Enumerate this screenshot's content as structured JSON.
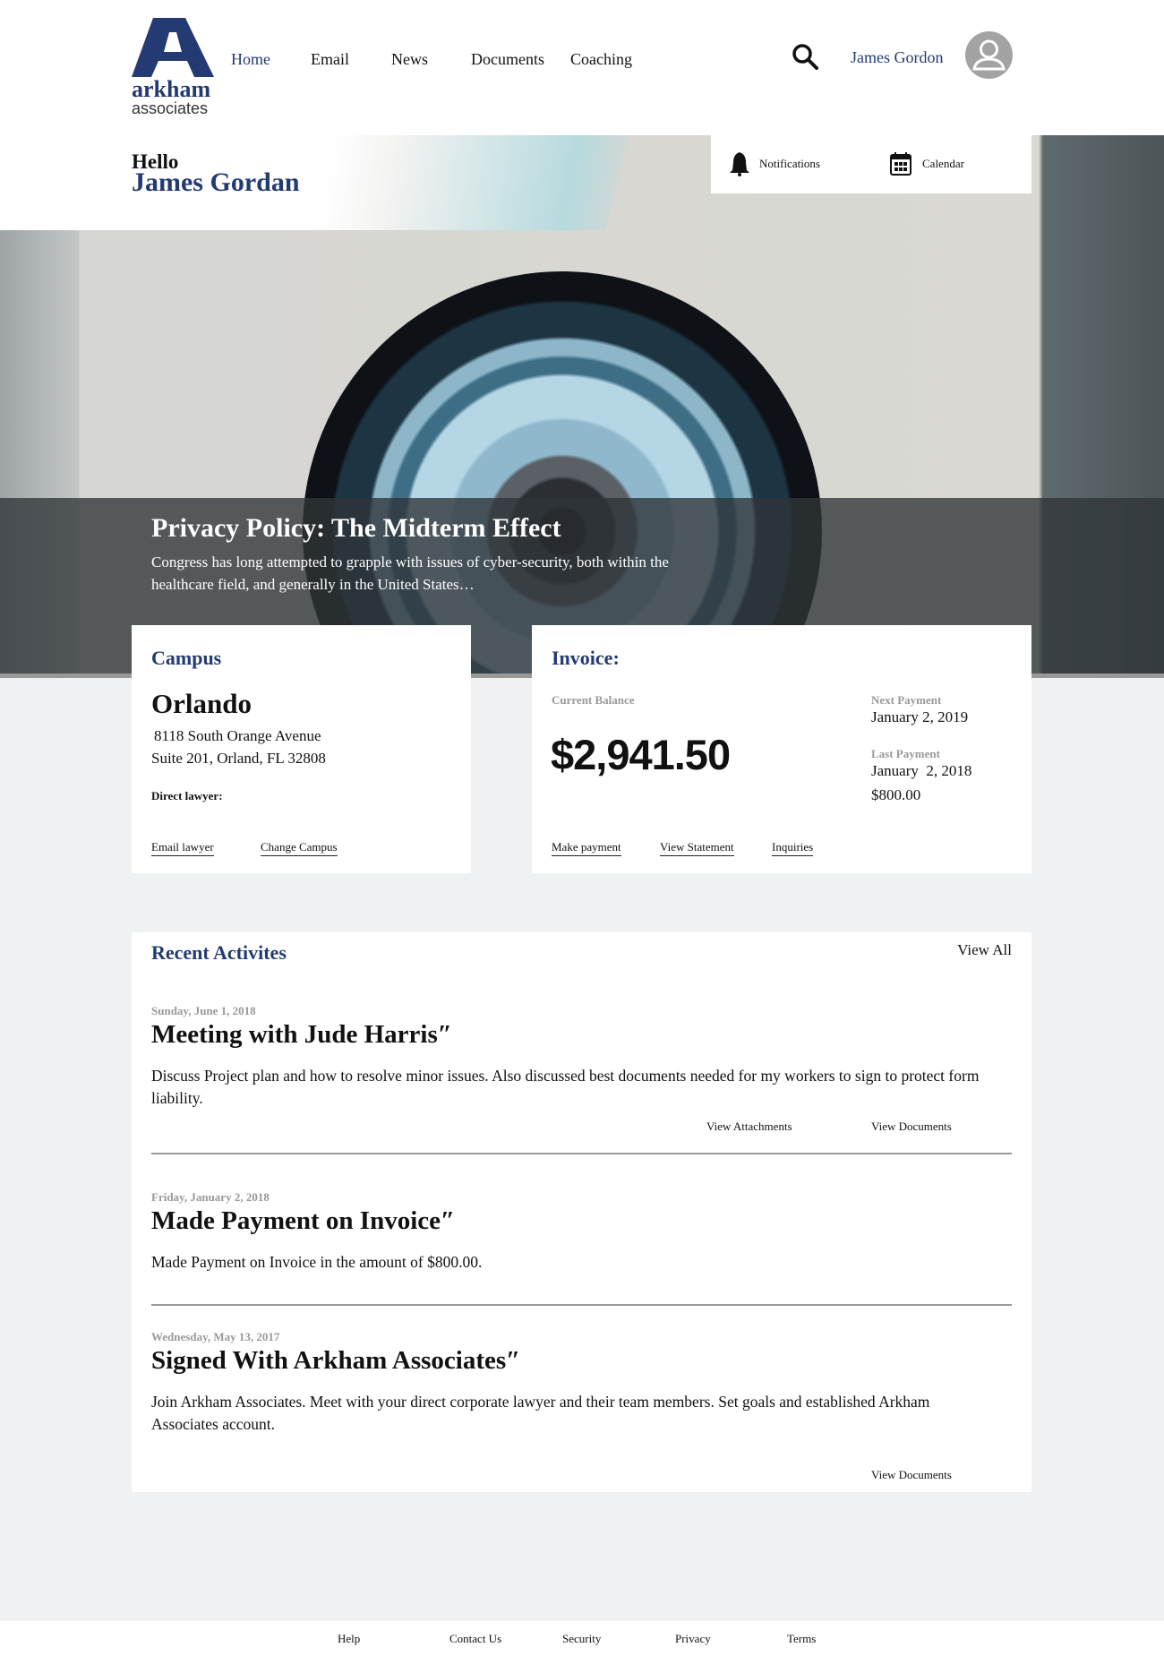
{
  "brand": {
    "logo_letter": "A",
    "name": "arkham",
    "sub": "associates",
    "color": "#233a72"
  },
  "nav": {
    "items": [
      {
        "label": "Home",
        "active": true
      },
      {
        "label": "Email"
      },
      {
        "label": "News"
      },
      {
        "label": "Documents"
      },
      {
        "label": "Coaching"
      }
    ]
  },
  "user": {
    "name": "James Gordon",
    "search_icon": "search-icon",
    "avatar_icon": "user-avatar-icon"
  },
  "greeting": {
    "hello": "Hello",
    "name": "James Gordan"
  },
  "quick": {
    "notifications": "Notifications",
    "calendar": "Calendar"
  },
  "hero": {
    "title": "Privacy Policy: The Midterm Effect",
    "desc_line1": "Congress has long attempted to grapple with issues of cyber-security, both within the",
    "desc_line2": "healthcare field, and generally in the United States…"
  },
  "campus": {
    "heading": "Campus",
    "city": "Orlando",
    "address1": "8118 South Orange Avenue",
    "address2": "Suite 201, Orland, FL 32808",
    "lawyer_label": "Direct lawyer:",
    "links": [
      "Email lawyer",
      "Change Campus"
    ]
  },
  "invoice": {
    "heading": "Invoice:",
    "balance_label": "Current Balance",
    "balance": "$2,941.50",
    "next_label": "Next Payment",
    "next_date": "January 2, 2019",
    "last_label": "Last Payment",
    "last_date": "January  2, 2018",
    "last_amount": "$800.00",
    "links": [
      "Make payment",
      "View Statement",
      "Inquiries"
    ]
  },
  "activities": {
    "heading": "Recent Activites",
    "view_all": "View All",
    "items": [
      {
        "date": "Sunday, June 1, 2018",
        "title": "Meeting with Jude Harris″",
        "desc": "Discuss Project plan and how to resolve minor issues. Also discussed  best documents needed for my workers to sign to protect form liability.",
        "links": [
          "View Attachments",
          "View Documents"
        ]
      },
      {
        "date": "Friday, January 2, 2018",
        "title": "Made Payment on Invoice″",
        "desc": "Made Payment on Invoice in the amount of $800.00."
      },
      {
        "date": "Wednesday, May 13, 2017",
        "title": "Signed With Arkham Associates″",
        "desc": "Join Arkham Associates. Meet with your direct corporate lawyer and their team members. Set goals and established Arkham Associates account.",
        "links": [
          "View Documents"
        ]
      }
    ]
  },
  "footer": {
    "links": [
      "Help",
      "Contact Us",
      "Security",
      "Privacy",
      "Terms"
    ]
  }
}
